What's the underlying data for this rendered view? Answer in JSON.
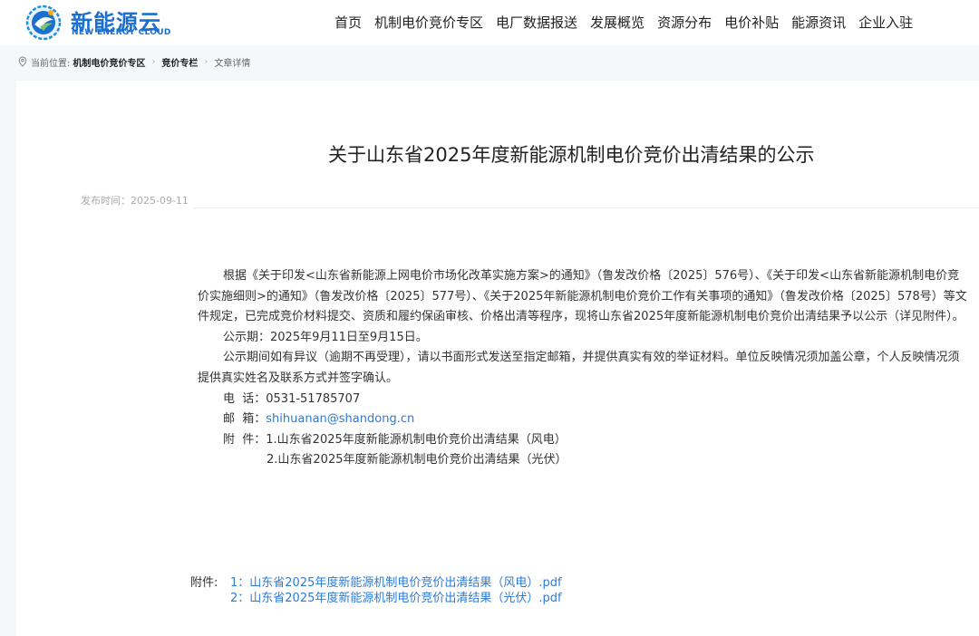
{
  "logo": {
    "title": "新能源云",
    "subtitle": "NEW ENERGY CLOUD"
  },
  "nav": [
    "首页",
    "机制电价竞价专区",
    "电厂数据报送",
    "发展概览",
    "资源分布",
    "电价补贴",
    "能源资讯",
    "企业入驻"
  ],
  "breadcrumb": {
    "prefix": "当前位置:",
    "items": [
      "机制电价竞价专区",
      "竞价专栏",
      "文章详情"
    ]
  },
  "article": {
    "title": "关于山东省2025年度新能源机制电价竞价出清结果的公示",
    "publish_time": "发布时间：2025-09-11",
    "p1": "根据《关于印发<山东省新能源上网电价市场化改革实施方案>的通知》（鲁发改价格〔2025〕576号）、《关于印发<山东省新能源机制电价竞价实施细则>的通知》（鲁发改价格〔2025〕577号）、《关于2025年新能源机制电价竞价工作有关事项的通知》（鲁发改价格〔2025〕578号）等文件规定，已完成竞价材料提交、资质和履约保函审核、价格出清等程序，现将山东省2025年度新能源机制电价竞价出清结果予以公示（详见附件）。",
    "p2": "公示期：2025年9月11日至9月15日。",
    "p3": "公示期间如有异议（逾期不再受理），请以书面形式发送至指定邮箱，并提供真实有效的举证材料。单位反映情况须加盖公章，个人反映情况须提供真实姓名及联系方式并签字确认。",
    "phone_label": "电  话：",
    "phone": "0531-51785707",
    "email_label": "邮  箱：",
    "email": "shihuanan@shandong.cn",
    "attach_label": "附  件：",
    "attach1": "1.山东省2025年度新能源机制电价竞价出清结果（风电）",
    "attach2": "2.山东省2025年度新能源机制电价竞价出清结果（光伏）"
  },
  "files": {
    "label": "附件:",
    "items": [
      "1：山东省2025年度新能源机制电价竞价出清结果（风电）.pdf",
      "2：山东省2025年度新能源机制电价竞价出清结果（光伏）.pdf"
    ]
  },
  "colors": {
    "brand": "#1a6fd1",
    "link": "#2b7bd6",
    "background": "#f5f7fa"
  }
}
